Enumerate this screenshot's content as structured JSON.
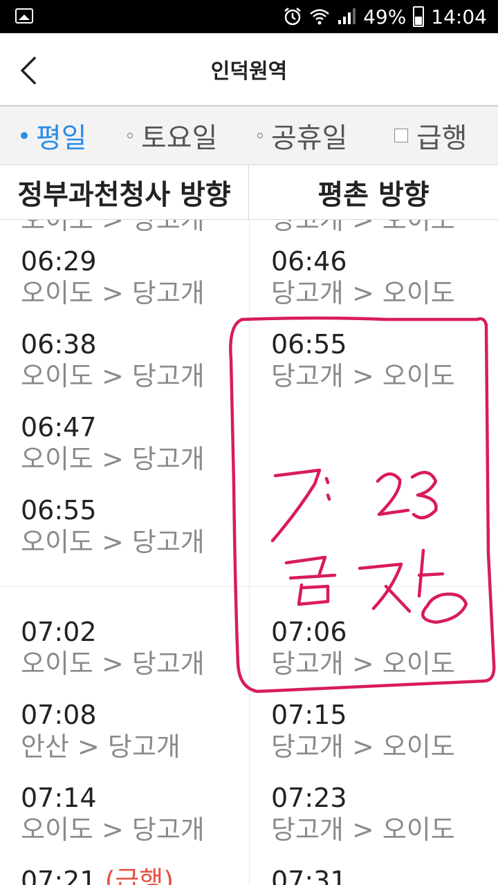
{
  "status_bar": {
    "battery_percent": "49%",
    "time": "14:04"
  },
  "header": {
    "title": "인덕원역"
  },
  "tabs": [
    {
      "label": "평일",
      "active": true
    },
    {
      "label": "토요일",
      "active": false
    },
    {
      "label": "공휴일",
      "active": false
    },
    {
      "label": "급행",
      "checkbox": true
    }
  ],
  "directions": {
    "left": "정부과천청사 방향",
    "right": "평촌 방향"
  },
  "left_column": [
    {
      "time": "06:29",
      "route": "오이도 > 당고개"
    },
    {
      "time": "06:38",
      "route": "오이도 > 당고개"
    },
    {
      "time": "06:47",
      "route": "오이도 > 당고개"
    },
    {
      "time": "06:55",
      "route": "오이도 > 당고개"
    },
    {
      "time": "07:02",
      "route": "오이도 > 당고개"
    },
    {
      "time": "07:08",
      "route": "안산 > 당고개"
    },
    {
      "time": "07:14",
      "route": "오이도 > 당고개"
    },
    {
      "time": "07:21",
      "express": "(급행)"
    }
  ],
  "right_column": [
    {
      "time": "06:46",
      "route": "당고개 > 오이도"
    },
    {
      "time": "06:55",
      "route": "당고개 > 오이도"
    },
    {
      "time": "07:06",
      "route": "당고개 > 오이도"
    },
    {
      "time": "07:15",
      "route": "당고개 > 오이도"
    },
    {
      "time": "07:23",
      "route": "당고개 > 오이도"
    },
    {
      "time": "07:31"
    }
  ],
  "cut_off_top": {
    "left": "오이도 > 당고개",
    "right": "당고개 > 오이도"
  },
  "annotation": {
    "text_line1": "7:23",
    "text_line2": "금정",
    "color": "#d81b60"
  }
}
